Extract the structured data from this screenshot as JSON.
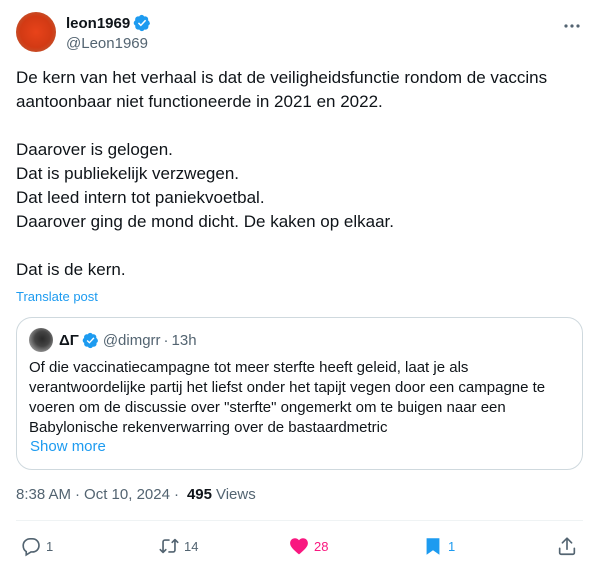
{
  "author": {
    "display_name": "leon1969",
    "handle": "@Leon1969"
  },
  "post": {
    "paragraphs": [
      "De kern van het verhaal is dat de veiligheidsfunctie rondom de vaccins aantoonbaar niet functioneerde in 2021 en 2022.",
      "",
      "Daarover is gelogen.",
      "Dat is publiekelijk verzwegen.",
      "Dat leed intern tot paniekvoetbal.",
      "Daarover ging de mond dicht. De kaken op elkaar.",
      "",
      "Dat is de kern."
    ],
    "translate_label": "Translate post"
  },
  "quote": {
    "display_name": "ΔΓ",
    "handle": "@dimgrr",
    "separator": "·",
    "time": "13h",
    "text": "Of die vaccinatiecampagne tot meer sterfte heeft geleid, laat je als verantwoordelijke partij het liefst onder het tapijt vegen door een campagne te voeren om de discussie over \"sterfte\" ongemerkt om te buigen naar een Babylonische rekenverwarring over de bastaardmetric",
    "show_more": "Show more"
  },
  "meta": {
    "time": "8:38 AM",
    "separator": "·",
    "date": "Oct 10, 2024",
    "views_count": "495",
    "views_label": "Views"
  },
  "actions": {
    "replies": "1",
    "reposts": "14",
    "likes": "28",
    "bookmarks": "1"
  },
  "colors": {
    "accent": "#1d9bf0",
    "like": "#f91880",
    "muted": "#536471",
    "text": "#0f1419"
  },
  "icons": [
    "verified-badge-icon",
    "more-icon",
    "reply-icon",
    "repost-icon",
    "like-icon",
    "bookmark-icon",
    "share-icon"
  ]
}
